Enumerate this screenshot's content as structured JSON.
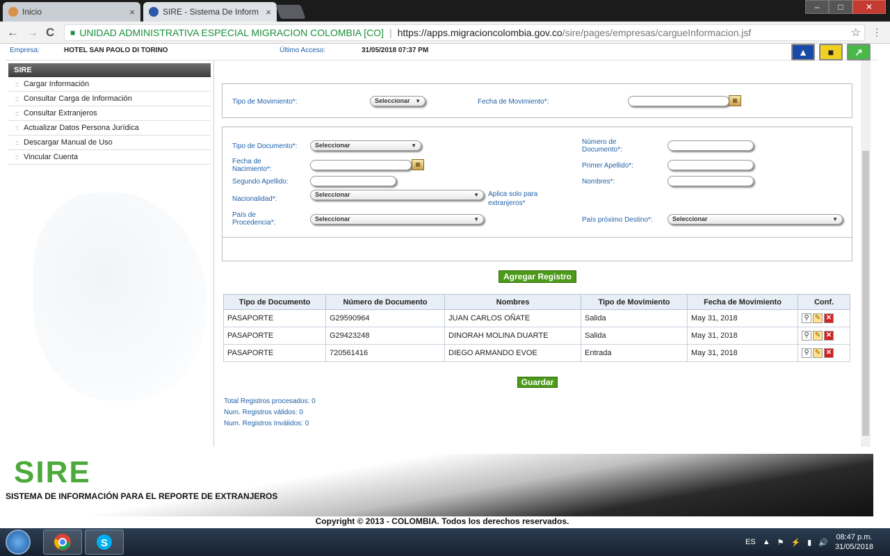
{
  "browser": {
    "tabs": [
      {
        "title": "Inicio",
        "close": "×"
      },
      {
        "title": "SIRE - Sistema De Inform",
        "close": "×"
      }
    ],
    "window_buttons": [
      "–",
      "□",
      "✕"
    ],
    "nav": {
      "back": "←",
      "forward": "→",
      "reload": "C"
    },
    "address": {
      "org": "UNIDAD ADMINISTRATIVA ESPECIAL MIGRACION COLOMBIA [CO]",
      "separator": "|",
      "url_host": "https://apps.migracioncolombia.gov.co",
      "url_path": "/sire/pages/empresas/cargueInformacion.jsf"
    },
    "star": "☆",
    "menu": "⋮"
  },
  "infobar": {
    "empresa_label": "Empresa:",
    "empresa_value": "HOTEL SAN PAOLO DI TORINO",
    "acceso_label": "Último Acceso:",
    "acceso_value": "31/05/2018 07:37 PM"
  },
  "sidebar": {
    "header": "SIRE",
    "items": [
      {
        "label": "Cargar Información"
      },
      {
        "label": "Consultar Carga de Información"
      },
      {
        "label": "Consultar Extranjeros"
      },
      {
        "label": "Actualizar Datos Persona Jurídica"
      },
      {
        "label": "Descargar Manual de Uso"
      },
      {
        "label": "Vincular Cuenta"
      }
    ]
  },
  "form1": {
    "tipo_mov_label": "Tipo de Movimiento*:",
    "tipo_mov_value": "Seleccionar",
    "fecha_mov_label": "Fecha de Movimiento*:",
    "fecha_mov_value": ""
  },
  "form2": {
    "tipo_doc_label": "Tipo de Documento*:",
    "tipo_doc_value": "Seleccionar",
    "num_doc_label": "Número de Documento*:",
    "fecha_nac_label": "Fecha de Nacimiento*:",
    "primer_apellido_label": "Primer Apellido*:",
    "segundo_apellido_label": "Segundo Apellido:",
    "nombres_label": "Nombres*:",
    "nacionalidad_label": "Nacionalidad*:",
    "nacionalidad_value": "Seleccionar",
    "nacionalidad_note": "Aplica solo para extranjeros*",
    "pais_proc_label": "País de Procedencia*:",
    "pais_proc_value": "Seleccionar",
    "pais_dest_label": "País próximo Destino*:",
    "pais_dest_value": "Seleccionar"
  },
  "buttons": {
    "agregar": "Agregar Registro",
    "guardar": "Guardar"
  },
  "table": {
    "headers": [
      "Tipo de Documento",
      "Número de Documento",
      "Nombres",
      "Tipo de Movimiento",
      "Fecha de Movimiento",
      "Conf."
    ],
    "rows": [
      [
        "PASAPORTE",
        "G29590964",
        "JUAN CARLOS OÑATE",
        "Salida",
        "May 31, 2018"
      ],
      [
        "PASAPORTE",
        "G29423248",
        "DINORAH MOLINA DUARTE",
        "Salida",
        "May 31, 2018"
      ],
      [
        "PASAPORTE",
        "720561416",
        "DIEGO ARMANDO EVOE",
        "Entrada",
        "May 31, 2018"
      ]
    ]
  },
  "counts": {
    "total": "Total Registros procesados: 0",
    "validos": "Num. Registros válidos: 0",
    "invalidos": "Num. Registros Inválidos: 0"
  },
  "footer": {
    "logo": "SIRE",
    "subtitle": "SISTEMA DE INFORMACIÓN PARA EL REPORTE DE EXTRANJEROS",
    "copyright": "Copyright © 2013 - COLOMBIA. Todos los derechos reservados."
  },
  "taskbar": {
    "lang": "ES",
    "time": "08:47 p.m.",
    "date": "31/05/2018"
  }
}
